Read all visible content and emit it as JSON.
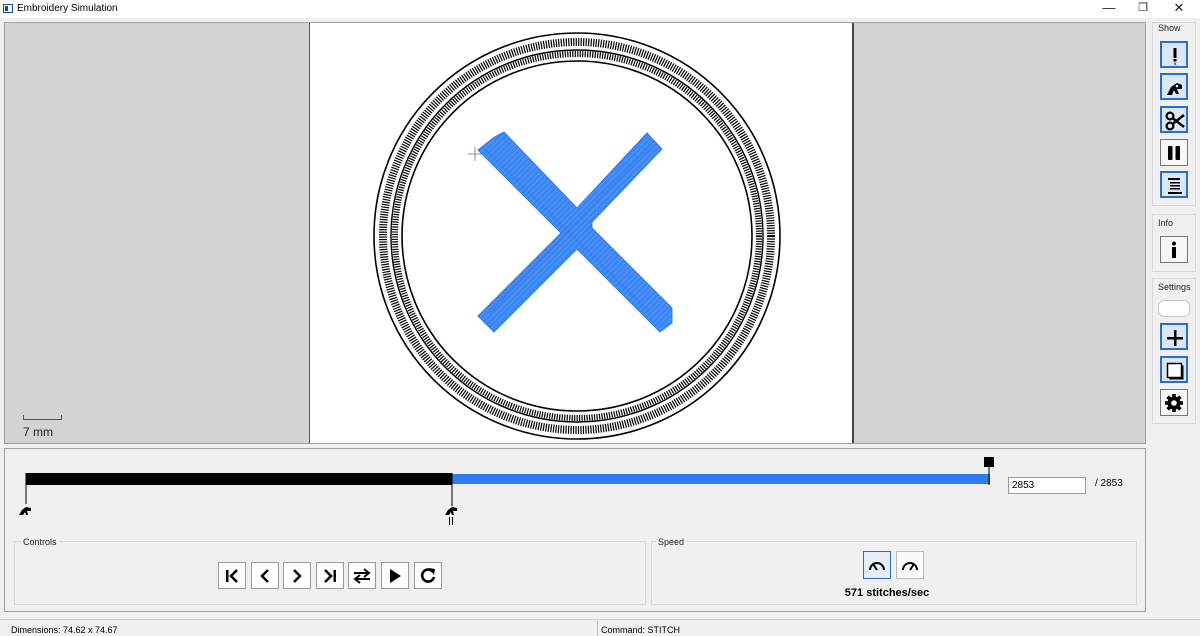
{
  "window": {
    "title": "Embroidery Simulation",
    "minimize_glyph": "—",
    "restore_glyph": "❐",
    "close_glyph": "✕"
  },
  "canvas": {
    "scale_label": "7 mm",
    "stitch_color": "#2f7cf0",
    "hoop_color": "#000000"
  },
  "sidebar": {
    "show_label": "Show",
    "info_label": "Info",
    "settings_label": "Settings",
    "show_buttons": [
      {
        "icon": "jump-marker-icon",
        "active": true
      },
      {
        "icon": "trim-presser-foot-icon",
        "active": true
      },
      {
        "icon": "scissors-icon",
        "active": true
      },
      {
        "icon": "pause-icon",
        "active": false
      },
      {
        "icon": "color-change-icon",
        "active": true
      }
    ],
    "info_buttons": [
      {
        "icon": "info-icon",
        "active": false
      }
    ],
    "settings_buttons": [
      {
        "icon": "blank-swatch-icon",
        "active": false
      },
      {
        "icon": "plus-icon",
        "active": true
      },
      {
        "icon": "page-icon",
        "active": true
      },
      {
        "icon": "gear-icon",
        "active": false
      }
    ]
  },
  "timeline": {
    "current_stitch": "2853",
    "total_label": "/ 2853",
    "progress_fraction": 1.0,
    "color_change_fraction": 0.442
  },
  "controls": {
    "label": "Controls",
    "buttons": [
      {
        "icon": "skip-to-start-icon"
      },
      {
        "icon": "step-back-icon"
      },
      {
        "icon": "step-forward-icon"
      },
      {
        "icon": "skip-to-end-icon"
      },
      {
        "icon": "swap-direction-icon"
      },
      {
        "icon": "play-icon"
      },
      {
        "icon": "restart-icon"
      }
    ]
  },
  "speed": {
    "label": "Speed",
    "value_text": "571 stitches/sec",
    "buttons": [
      {
        "icon": "speed-slower-icon",
        "active": true
      },
      {
        "icon": "speed-faster-icon",
        "active": false
      }
    ]
  },
  "status": {
    "dimensions": "Dimensions: 74.62 x 74.67",
    "command": "Command: STITCH"
  }
}
